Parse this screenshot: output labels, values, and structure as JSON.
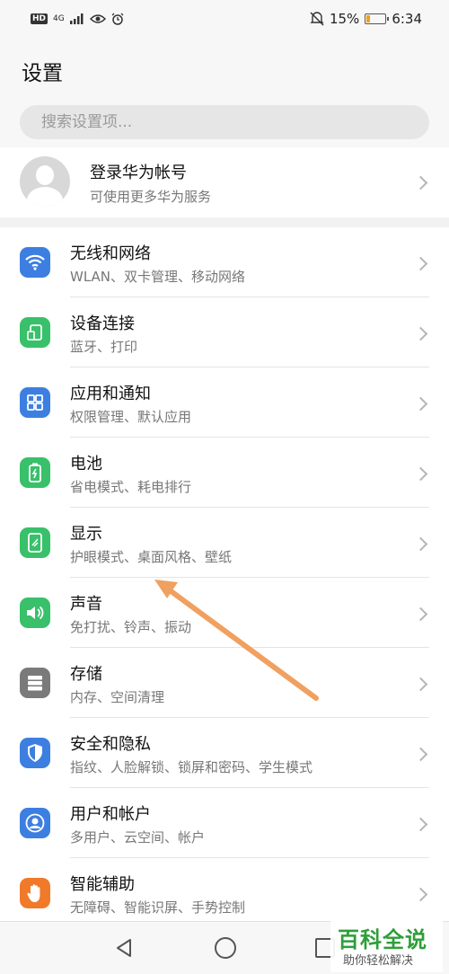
{
  "status": {
    "net": "HD",
    "signal": "4G",
    "battery_pct_text": "15%",
    "battery_fraction": 0.15,
    "time": "6:34"
  },
  "header": {
    "title": "设置"
  },
  "search": {
    "placeholder": "搜索设置项..."
  },
  "account": {
    "title": "登录华为帐号",
    "subtitle": "可使用更多华为服务"
  },
  "items": [
    {
      "title": "无线和网络",
      "subtitle": "WLAN、双卡管理、移动网络",
      "icon": "wifi-icon",
      "color": "#3d7fe0"
    },
    {
      "title": "设备连接",
      "subtitle": "蓝牙、打印",
      "icon": "device-connect-icon",
      "color": "#39c06a"
    },
    {
      "title": "应用和通知",
      "subtitle": "权限管理、默认应用",
      "icon": "apps-grid-icon",
      "color": "#3d7fe0"
    },
    {
      "title": "电池",
      "subtitle": "省电模式、耗电排行",
      "icon": "battery-icon",
      "color": "#39c06a"
    },
    {
      "title": "显示",
      "subtitle": "护眼模式、桌面风格、壁纸",
      "icon": "display-icon",
      "color": "#39c06a"
    },
    {
      "title": "声音",
      "subtitle": "免打扰、铃声、振动",
      "icon": "speaker-icon",
      "color": "#39c06a"
    },
    {
      "title": "存储",
      "subtitle": "内存、空间清理",
      "icon": "storage-icon",
      "color": "#7a7a7a"
    },
    {
      "title": "安全和隐私",
      "subtitle": "指纹、人脸解锁、锁屏和密码、学生模式",
      "icon": "shield-icon",
      "color": "#3d7fe0"
    },
    {
      "title": "用户和帐户",
      "subtitle": "多用户、云空间、帐户",
      "icon": "user-icon",
      "color": "#3d7fe0"
    },
    {
      "title": "智能辅助",
      "subtitle": "无障碍、智能识屏、手势控制",
      "icon": "hand-icon",
      "color": "#f07a2a"
    }
  ],
  "watermark": {
    "title": "百科全说",
    "subtitle": "助你轻松解决"
  },
  "annotation_color": "#f0a060"
}
